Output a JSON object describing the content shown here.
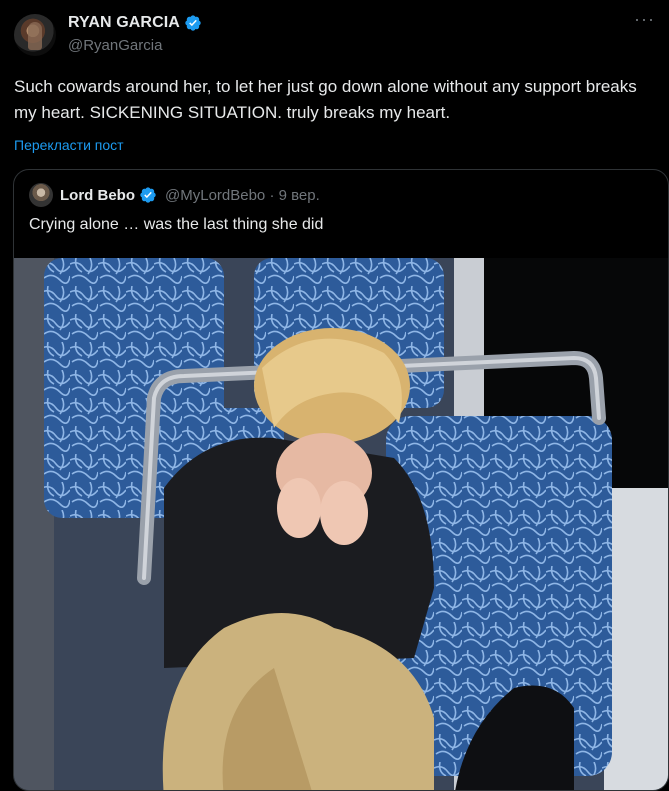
{
  "author": {
    "name": "RYAN GARCIA",
    "handle": "@RyanGarcia"
  },
  "more_label": "···",
  "post_text": "Such cowards around her, to let her just go down alone without any support breaks my heart. SICKENING SITUATION. truly breaks my heart.",
  "translate_label": "Перекласти пост",
  "quote": {
    "name": "Lord Bebo",
    "handle": "@MyLordBebo · 9 вер.",
    "text": "Crying alone … was the last thing she did"
  },
  "colors": {
    "background": "#000000",
    "text": "#e7e9ea",
    "secondary": "#71767b",
    "link": "#1d9bf0",
    "verified": "#1d9bf0",
    "border": "#2f3336"
  },
  "icons": [
    "verified-badge-icon",
    "more-options-icon"
  ]
}
